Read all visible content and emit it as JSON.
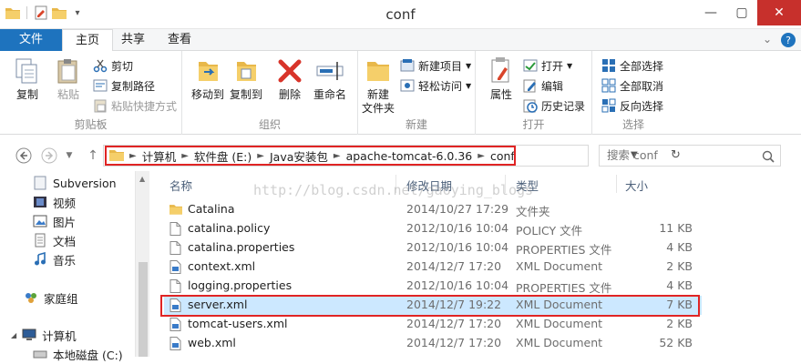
{
  "window": {
    "title": "conf"
  },
  "quick_access": {
    "dropdown": "▾"
  },
  "tabs": [
    {
      "label": "文件"
    },
    {
      "label": "主页"
    },
    {
      "label": "共享"
    },
    {
      "label": "查看"
    }
  ],
  "ribbon": {
    "clipboard": {
      "label": "剪贴板",
      "copy": "复制",
      "paste": "粘贴",
      "cut": "剪切",
      "copy_path": "复制路径",
      "paste_shortcut": "粘贴快捷方式"
    },
    "organize": {
      "label": "组织",
      "move_to": "移动到",
      "copy_to": "复制到",
      "delete": "删除",
      "rename": "重命名"
    },
    "new": {
      "label": "新建",
      "new_folder": "新建\n文件夹",
      "new_item": "新建项目",
      "easy_access": "轻松访问"
    },
    "open": {
      "label": "打开",
      "properties": "属性",
      "open": "打开",
      "edit": "编辑",
      "history": "历史记录"
    },
    "select": {
      "label": "选择",
      "select_all": "全部选择",
      "select_none": "全部取消",
      "invert": "反向选择"
    }
  },
  "address": {
    "crumbs": [
      "计算机",
      "软件盘 (E:)",
      "Java安装包",
      "apache-tomcat-6.0.36",
      "conf"
    ],
    "search_placeholder": "搜索 conf"
  },
  "nav": {
    "items": [
      {
        "label": "Subversion"
      },
      {
        "label": "视频"
      },
      {
        "label": "图片"
      },
      {
        "label": "文档"
      },
      {
        "label": "音乐"
      },
      {
        "label": "家庭组"
      },
      {
        "label": "计算机"
      },
      {
        "label": "本地磁盘 (C:)"
      }
    ]
  },
  "columns": {
    "name": "名称",
    "modified": "修改日期",
    "type": "类型",
    "size": "大小"
  },
  "watermark": "http://blog.csdn.net/gaoying_blogs",
  "files": [
    {
      "name": "Catalina",
      "modified": "2014/10/27 17:29",
      "type": "文件夹",
      "size": "",
      "icon": "folder-icon"
    },
    {
      "name": "catalina.policy",
      "modified": "2012/10/16 10:04",
      "type": "POLICY 文件",
      "size": "11 KB",
      "icon": "file-icon"
    },
    {
      "name": "catalina.properties",
      "modified": "2012/10/16 10:04",
      "type": "PROPERTIES 文件",
      "size": "4 KB",
      "icon": "file-icon"
    },
    {
      "name": "context.xml",
      "modified": "2014/12/7 17:20",
      "type": "XML Document",
      "size": "2 KB",
      "icon": "xml-file-icon"
    },
    {
      "name": "logging.properties",
      "modified": "2012/10/16 10:04",
      "type": "PROPERTIES 文件",
      "size": "4 KB",
      "icon": "file-icon"
    },
    {
      "name": "server.xml",
      "modified": "2014/12/7 19:22",
      "type": "XML Document",
      "size": "7 KB",
      "icon": "xml-file-icon"
    },
    {
      "name": "tomcat-users.xml",
      "modified": "2014/12/7 17:20",
      "type": "XML Document",
      "size": "2 KB",
      "icon": "xml-file-icon"
    },
    {
      "name": "web.xml",
      "modified": "2014/12/7 17:20",
      "type": "XML Document",
      "size": "52 KB",
      "icon": "xml-file-icon"
    }
  ],
  "colors": {
    "accent": "#1e73be",
    "highlight_red": "#e02424",
    "selection": "#cce8ff"
  }
}
